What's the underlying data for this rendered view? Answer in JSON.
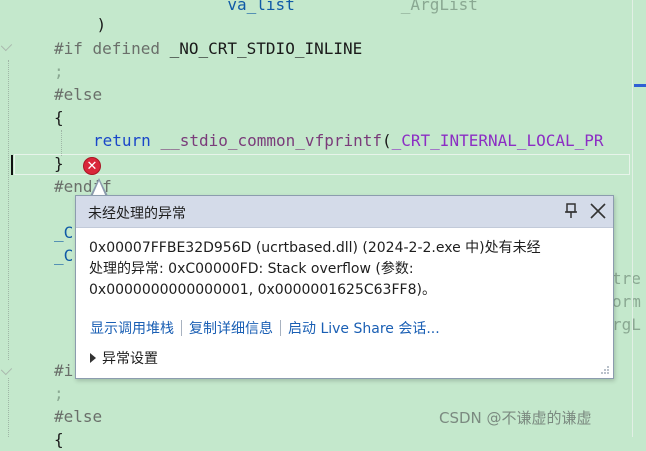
{
  "code": {
    "line1": {
      "indent": "                  ",
      "token": "va_list",
      "pad": "           ",
      "arg": "_ArgList"
    },
    "line2": "    )",
    "line3": {
      "directive": "#if defined ",
      "macro": "_NO_CRT_STDIO_INLINE"
    },
    "line4": ";",
    "line5": "#else",
    "line6": "{",
    "line7": {
      "keyword": "return ",
      "func": "__stdio_common_vfprintf",
      "paren": "(",
      "macro": "_CRT_INTERNAL_LOCAL_PR"
    },
    "line8": "}",
    "line9": "#endif",
    "frag_c1": "_C",
    "frag_c2": "_C",
    "frag_tre": "tre",
    "frag_orm": "orm",
    "frag_rgl": "rgL",
    "frag_i": "#i",
    "line_semicolon2": ";",
    "line_else2": "#else",
    "line_brace2": "{"
  },
  "popup": {
    "title": "未经处理的异常",
    "pin_icon": "pin-icon",
    "close_icon": "close-icon",
    "message_line1": "0x00007FFBE32D956D (ucrtbased.dll) (2024-2-2.exe 中)处有未经",
    "message_line2": "处理的异常: 0xC00000FD: Stack overflow (参数:",
    "message_line3": "0x0000000000000001, 0x0000001625C63FF8)。",
    "links": [
      "显示调用堆栈",
      "复制详细信息",
      "启动 Live Share 会话..."
    ],
    "exception_settings": "异常设置"
  },
  "error_icon": "error-icon",
  "watermark": "CSDN @不谦虚的谦虚",
  "colors": {
    "editor_bg": "#c4e8cc",
    "popup_header": "#d4dbe9",
    "link": "#1a5fb4",
    "error": "#d9263a"
  }
}
